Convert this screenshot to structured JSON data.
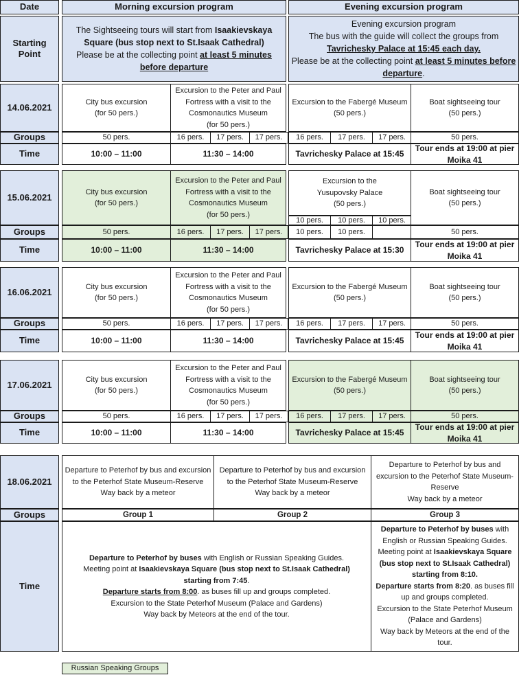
{
  "header": {
    "date": "Date",
    "morning": "Morning excursion program",
    "evening": "Evening excursion program"
  },
  "starting_point": {
    "label": "Starting Point",
    "morning": {
      "line1": "The Sightseeing tours will start from ",
      "line1_bold": "Isaakievskaya Square (bus stop next to St.Isaak Cathedral)",
      "line2": "Please be at the collecting point ",
      "line2_u": "at least 5 minutes before departure"
    },
    "evening": {
      "line1": "Evening excursion program",
      "line2": "The bus with the guide will collect the groups from",
      "line3_u": "Tavrichesky Palace at 15:45 each day.",
      "line4": "Please be at the collecting point ",
      "line4_u": "at least 5 minutes before departure",
      "line4_end": "."
    }
  },
  "row_labels": {
    "groups": "Groups",
    "time": "Time"
  },
  "days": [
    {
      "date": "14.06.2021",
      "city_bus": {
        "title": "City bus excursion",
        "sub": "(for 50 pers.)",
        "groups": "50 pers.",
        "time": "10:00 – 11:00"
      },
      "fortress": {
        "l1": "Excursion to the Peter and Paul",
        "l2": "Fortress with a visit to the",
        "l3": "Cosmonautics Museum",
        "l4": "(for 50 pers.)",
        "groups": [
          "16 pers.",
          "17 pers.",
          "17 pers."
        ],
        "time": "11:30 – 14:00"
      },
      "evening_museum": {
        "l1": "Excursion to the Fabergé Museum",
        "l2": "(50 pers.)",
        "l3": "",
        "groups": [
          "16 pers.",
          "17 pers.",
          "17 pers."
        ],
        "time": "Tavrichesky Palace at 15:45"
      },
      "boat": {
        "title": "Boat sightseeing tour",
        "sub": "(50 pers.)",
        "groups": "50 pers.",
        "time": "Tour ends at 19:00 at pier Moika 41"
      }
    },
    {
      "date": "15.06.2021",
      "city_bus": {
        "title": "City bus excursion",
        "sub": "(for 50 pers.)",
        "groups": "50 pers.",
        "time": "10:00 – 11:00"
      },
      "fortress": {
        "l1": "Excursion to the Peter and Paul",
        "l2": "Fortress with a visit to the",
        "l3": "Cosmonautics Museum",
        "l4": "(for 50 pers.)",
        "groups": [
          "16 pers.",
          "17 pers.",
          "17 pers."
        ],
        "time": "11:30 – 14:00"
      },
      "evening_museum": {
        "l1": "Excursion to the",
        "l2": "Yusupovsky Palace",
        "l3": "(50 pers.)",
        "groups": [
          "10 pers.",
          "10 pers.",
          "10 pers.",
          "10 pers.",
          "10 pers.",
          ""
        ],
        "time": "Tavrichesky Palace at 15:30"
      },
      "boat": {
        "title": "Boat sightseeing tour",
        "sub": "(50 pers.)",
        "groups": "50 pers.",
        "time": "Tour ends at 19:00 at pier Moika 41"
      }
    },
    {
      "date": "16.06.2021",
      "city_bus": {
        "title": "City bus excursion",
        "sub": "(for 50 pers.)",
        "groups": "50 pers.",
        "time": "10:00 – 11:00"
      },
      "fortress": {
        "l1": "Excursion to the Peter and Paul",
        "l2": "Fortress with a visit to the",
        "l3": "Cosmonautics Museum",
        "l4": "(for 50 pers.)",
        "groups": [
          "16 pers.",
          "17 pers.",
          "17 pers."
        ],
        "time": "11:30 – 14:00"
      },
      "evening_museum": {
        "l1": "Excursion to the Fabergé Museum",
        "l2": "(50 pers.)",
        "l3": "",
        "groups": [
          "16 pers.",
          "17 pers.",
          "17 pers."
        ],
        "time": "Tavrichesky Palace at 15:45"
      },
      "boat": {
        "title": "Boat sightseeing tour",
        "sub": "(50 pers.)",
        "groups": "50 pers.",
        "time": "Tour ends at 19:00 at pier Moika 41"
      }
    },
    {
      "date": "17.06.2021",
      "city_bus": {
        "title": "City bus excursion",
        "sub": "(for 50 pers.)",
        "groups": "50 pers.",
        "time": "10:00 – 11:00"
      },
      "fortress": {
        "l1": "Excursion to the Peter and Paul",
        "l2": "Fortress with a visit to the",
        "l3": "Cosmonautics Museum",
        "l4": "(for 50 pers.)",
        "groups": [
          "16 pers.",
          "17 pers.",
          "17 pers."
        ],
        "time": "11:30 – 14:00"
      },
      "evening_museum": {
        "l1": "Excursion to the Fabergé Museum",
        "l2": "(50 pers.)",
        "l3": "",
        "groups": [
          "16 pers.",
          "17 pers.",
          "17 pers."
        ],
        "time": "Tavrichesky Palace at 15:45"
      },
      "boat": {
        "title": "Boat sightseeing tour",
        "sub": "(50 pers.)",
        "groups": "50 pers.",
        "time": "Tour ends at 19:00 at pier Moika 41"
      }
    }
  ],
  "peterhof": {
    "date": "18.06.2021",
    "desc": {
      "l1": "Departure to Peterhof by bus and excursion",
      "l2": "to the Peterhof State Museum-Reserve",
      "l3": "Way back by a meteor",
      "g3_l1": "Departure to Peterhof by bus and",
      "g3_l2": "excursion to the  Peterhof State Museum-",
      "g3_l3": "Reserve"
    },
    "groups": [
      "Group 1",
      "Group 2",
      "Group 3"
    ],
    "time_12": {
      "p1_bold": "Departure to Peterhof by buses",
      "p1": " with English or Russian Speaking Guides.",
      "p2": "Meeting point at ",
      "p2_bold": "Isaakievskaya Square (bus stop next to St.Isaak Cathedral)",
      "p3_bold": "starting from 7:45",
      "p3": ".",
      "p4_u": "Departure starts from 8:00",
      "p4": ". as buses fill up and groups completed.",
      "p5": "Excursion to the State Peterhof Museum (Palace and Gardens)",
      "p6": "Way back by Meteors at the end of the tour."
    },
    "time_3": {
      "p1_bold": "Departure to Peterhof by buses",
      "p1": " with English or Russian Speaking Guides.",
      "p2": "Meeting point at ",
      "p2_bold": "Isaakievskaya Square (bus stop next to St.Isaak Cathedral) starting from 8:10.",
      "p3_bold": "Departure starts from 8:20",
      "p3": ". as buses fill up and groups completed.",
      "p4": "Excursion to the State Peterhof Museum (Palace and Gardens)",
      "p5": "Way back by Meteors at the end of the tour."
    }
  },
  "legend": {
    "label": "Russian Speaking Groups",
    "color": "#e2efda"
  },
  "colors": {
    "label_bg": "#dae3f3",
    "russian_bg": "#e2efda",
    "border": "#1a1a1a"
  }
}
